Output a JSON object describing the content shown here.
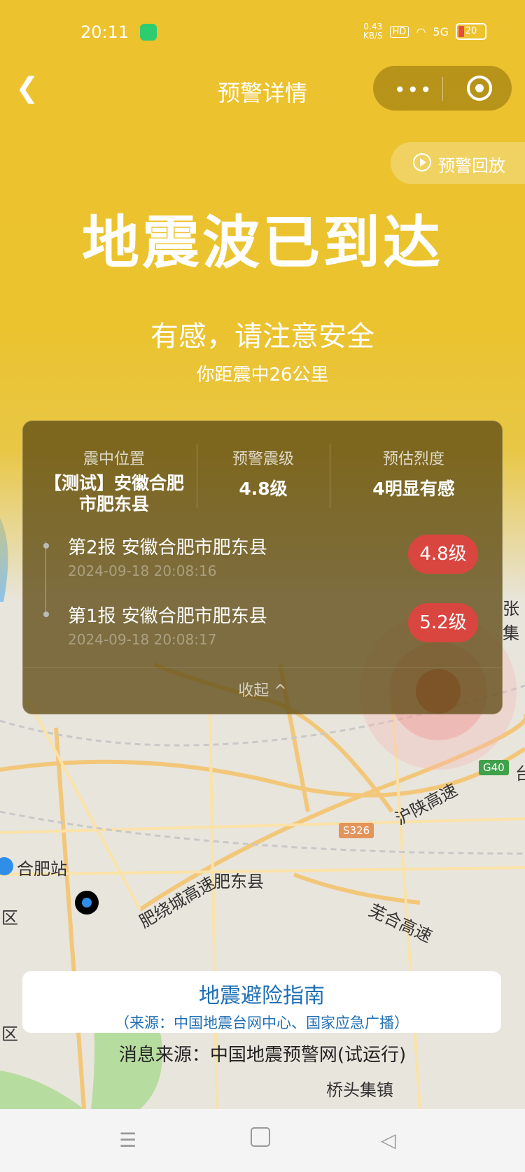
{
  "status_bar": {
    "time": "20:11",
    "net_speed": "0.43\nKB/S",
    "hd": "HD",
    "signal": "5G",
    "battery": "20"
  },
  "nav": {
    "title": "预警详情",
    "more_icon": "more-icon",
    "target_icon": "target-icon"
  },
  "replay": {
    "label": "预警回放"
  },
  "alert": {
    "headline": "地震波已到达",
    "advice": "有感，请注意安全",
    "distance": "你距震中26公里"
  },
  "summary": {
    "epicenter_label": "震中位置",
    "epicenter_value": "【测试】安徽合肥市肥东县",
    "magnitude_label": "预警震级",
    "magnitude_value": "4.8级",
    "intensity_label": "预估烈度",
    "intensity_value": "4明显有感"
  },
  "reports": [
    {
      "title": "第2报 安徽合肥市肥东县",
      "time": "2024-09-18 20:08:16",
      "magnitude": "4.8级"
    },
    {
      "title": "第1报 安徽合肥市肥东县",
      "time": "2024-09-18 20:08:17",
      "magnitude": "5.2级"
    }
  ],
  "collapse_label": "收起 ^",
  "map_labels": {
    "hefei_station": "合肥站",
    "feidong": "肥东县",
    "hushan": "沪陕高速",
    "s326": "S326",
    "g40": "G40",
    "ring": "肥绕城高速",
    "wuhe": "芜合高速",
    "qiaotou": "桥头集镇",
    "district1": "区",
    "district2": "区",
    "zhang": "张集",
    "tai": "台"
  },
  "guide": {
    "title": "地震避险指南",
    "source": "（来源：中国地震台网中心、国家应急广播）"
  },
  "footer_source": "消息来源：中国地震预警网(试运行)"
}
